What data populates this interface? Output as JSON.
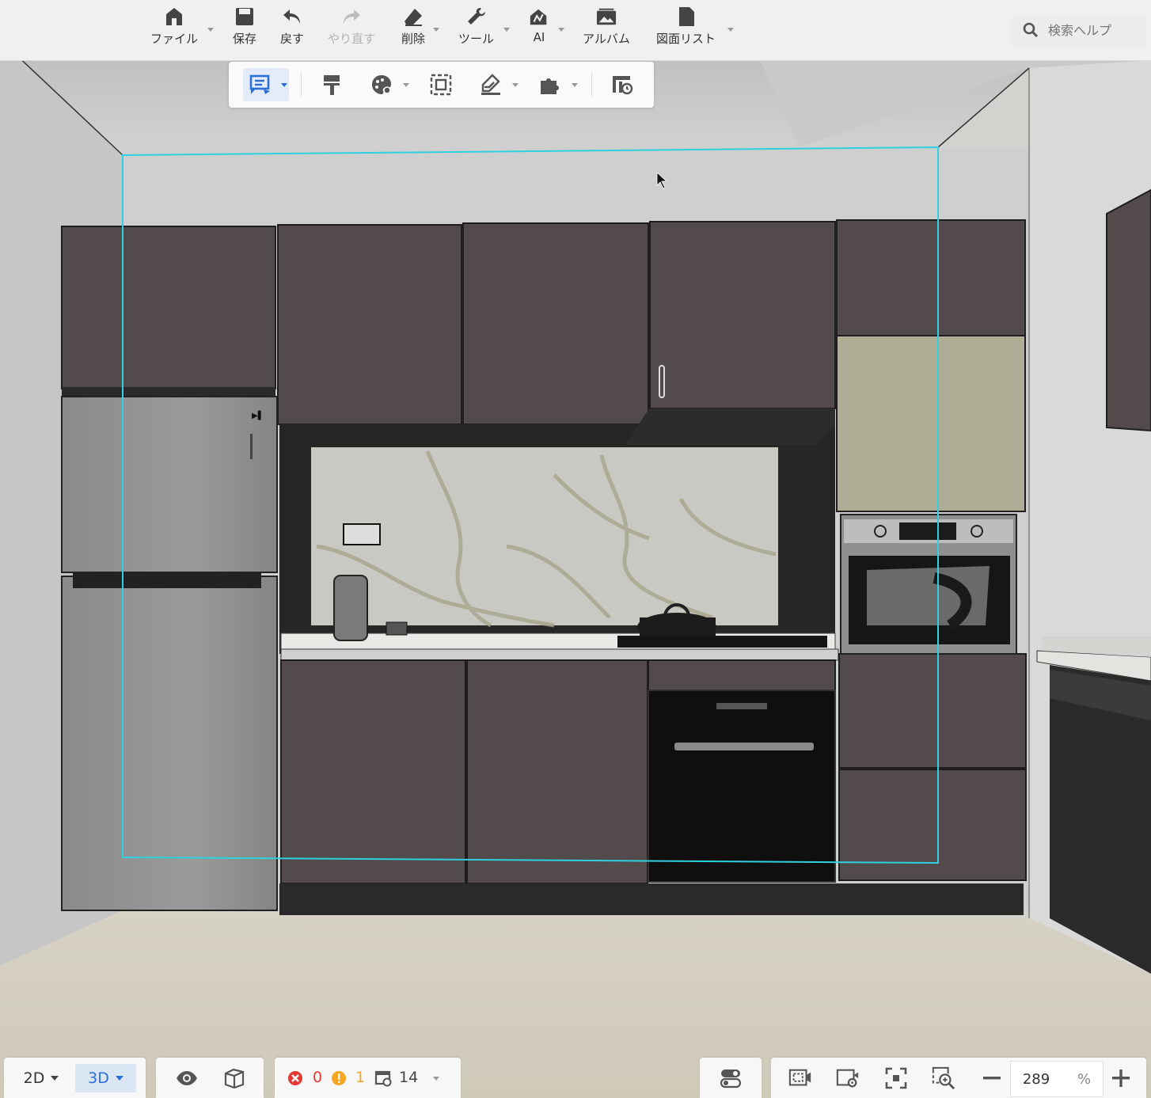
{
  "toolbar": {
    "file": "ファイル",
    "save": "保存",
    "undo": "戻す",
    "redo": "やり直す",
    "delete": "削除",
    "tools": "ツール",
    "ai": "AI",
    "album": "アルバム",
    "drawing_list": "図面リスト",
    "search_placeholder": "検索ヘルプ"
  },
  "subtoolbar": {
    "icons": [
      "catalog-icon",
      "paint-roller-icon",
      "palette-icon",
      "frame-select-icon",
      "material-brush-icon",
      "plugin-icon",
      "render-icon"
    ]
  },
  "bottom": {
    "view_2d": "2D",
    "view_3d": "3D",
    "active_view": "3D",
    "error_count": "0",
    "warning_count": "1",
    "item_count": "14",
    "zoom_value": "289",
    "zoom_unit": "%"
  },
  "colors": {
    "accent": "#2b6fd6",
    "cabinet": "#534a4c",
    "selection": "#2fd0e0",
    "error": "#e53935",
    "warning": "#f5a623"
  }
}
